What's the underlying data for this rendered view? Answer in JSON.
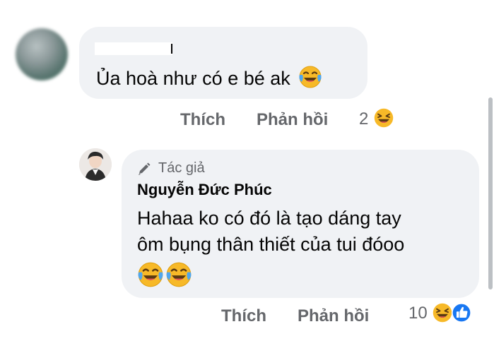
{
  "comment1": {
    "text": "Ủa hoà như có e bé ak",
    "emoji": "laughing-tears-emoji"
  },
  "comment1_actions": {
    "like": "Thích",
    "reply": "Phản hồi",
    "reaction_count": "2"
  },
  "reply": {
    "author_badge": "Tác giả",
    "author_name": "Nguyễn Đức Phúc",
    "line1": "Hahaa ko có đó là tạo dáng tay",
    "line2": "ôm bụng thân thiết của tui đóoo",
    "emojis": [
      "laughing-tears-emoji",
      "laughing-tears-emoji"
    ]
  },
  "reply_actions": {
    "like": "Thích",
    "reply": "Phản hồi",
    "reaction_count": "10"
  },
  "colors": {
    "bubble": "#f0f2f5",
    "secondary_text": "#65676b",
    "like_blue": "#1877f2",
    "emoji_yellow": "#f7b928"
  }
}
